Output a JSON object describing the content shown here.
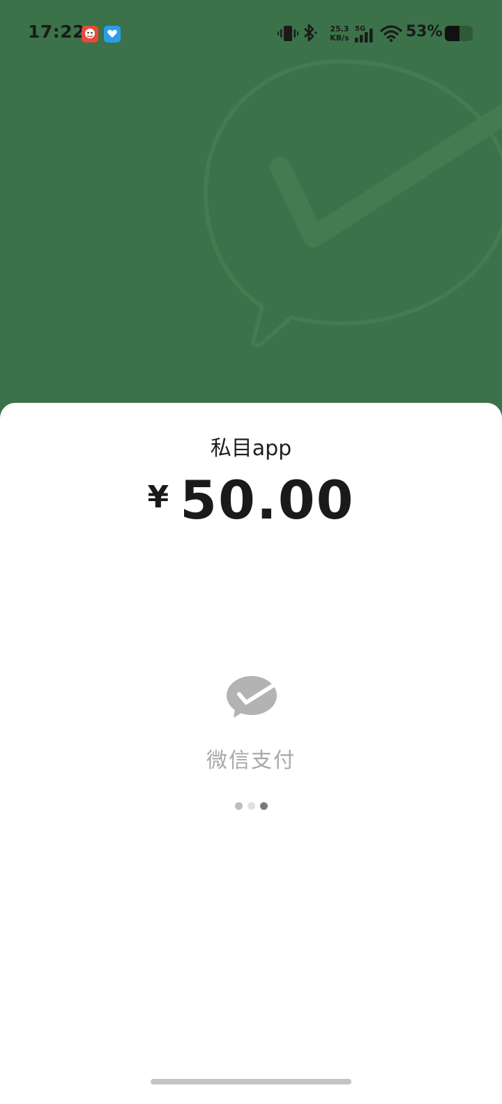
{
  "status_bar": {
    "time": "17:22",
    "net_speed_value": "25.3",
    "net_speed_unit": "KB/s",
    "network_type": "5G",
    "battery_percent": "53%",
    "battery_level": 0.53,
    "icons": [
      "app-notification-icon",
      "app-notification-icon-2",
      "vibrate-icon",
      "bluetooth-icon",
      "signal-icon",
      "wifi-icon",
      "battery-icon"
    ]
  },
  "payment": {
    "merchant": "私目app",
    "currency_symbol": "¥",
    "amount": "50.00",
    "method_label": "微信支付",
    "method_icon": "wechat-pay-icon",
    "loading_dots": 3
  },
  "colors": {
    "header_bg": "#3c7249",
    "sheet_bg": "#ffffff",
    "pay_gray": "#a8a8a8"
  }
}
